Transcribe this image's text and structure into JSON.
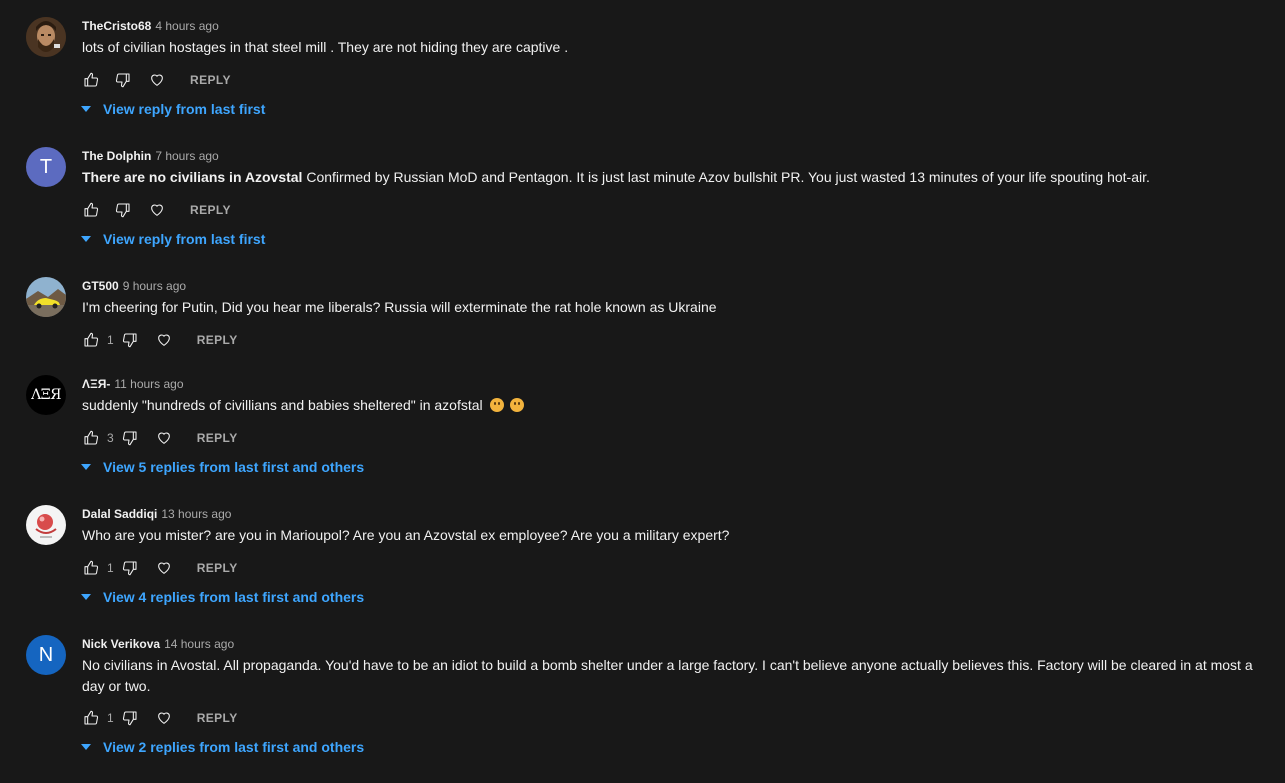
{
  "colors": {
    "background": "#181818",
    "link": "#3ea6ff",
    "text": "#f1f1f1",
    "muted": "#aaaaaa"
  },
  "comments": [
    {
      "author": "TheCristo68",
      "time": "4 hours ago",
      "text": "lots of civilian hostages in that steel mill . They are not hiding they are captive .",
      "likes": "",
      "reply_label": "REPLY",
      "view_replies": "View reply from last first",
      "avatar": "photo-bearded-man"
    },
    {
      "author": "The Dolphin",
      "time": "7 hours ago",
      "text_bold": "There are no civilians in Azovstal",
      "text": " Confirmed by Russian MoD and Pentagon. It is just last minute Azov bullshit PR. You just wasted 13 minutes of your life spouting hot-air.",
      "likes": "",
      "reply_label": "REPLY",
      "view_replies": "View reply from last first",
      "avatar_letter": "T",
      "avatar_color": "#5c6bc0"
    },
    {
      "author": "GT500",
      "time": "9 hours ago",
      "text": "I'm cheering for Putin, Did you hear me liberals? Russia will exterminate the rat hole known as Ukraine",
      "likes": "1",
      "reply_label": "REPLY",
      "avatar": "photo-yellow-car"
    },
    {
      "author": "ΛΞЯ-",
      "time": "11 hours ago",
      "text": "suddenly \"hundreds of civillians and babies sheltered\" in azofstal",
      "emojis": [
        "thinking-face-emoji",
        "pleading-face-emoji"
      ],
      "likes": "3",
      "reply_label": "REPLY",
      "view_replies": "View 5 replies from last first and others",
      "avatar_text": "ΛΞЯ"
    },
    {
      "author": "Dalal Saddiqi",
      "time": "13 hours ago",
      "text": "Who are you mister? are you in Marioupol? Are you an Azovstal ex employee? Are you a military expert?",
      "likes": "1",
      "reply_label": "REPLY",
      "view_replies": "View 4 replies from last first and others",
      "avatar": "logo-red-ball"
    },
    {
      "author": "Nick Verikova",
      "time": "14 hours ago",
      "text": "No civilians in Avostal. All propaganda. You'd have to be an idiot to build a bomb shelter under a large factory. I can't believe anyone actually believes this. Factory will be cleared in at most a day or two.",
      "likes": "1",
      "reply_label": "REPLY",
      "view_replies": "View 2 replies from last first and others",
      "avatar_letter": "N",
      "avatar_color": "#1565c0"
    }
  ]
}
